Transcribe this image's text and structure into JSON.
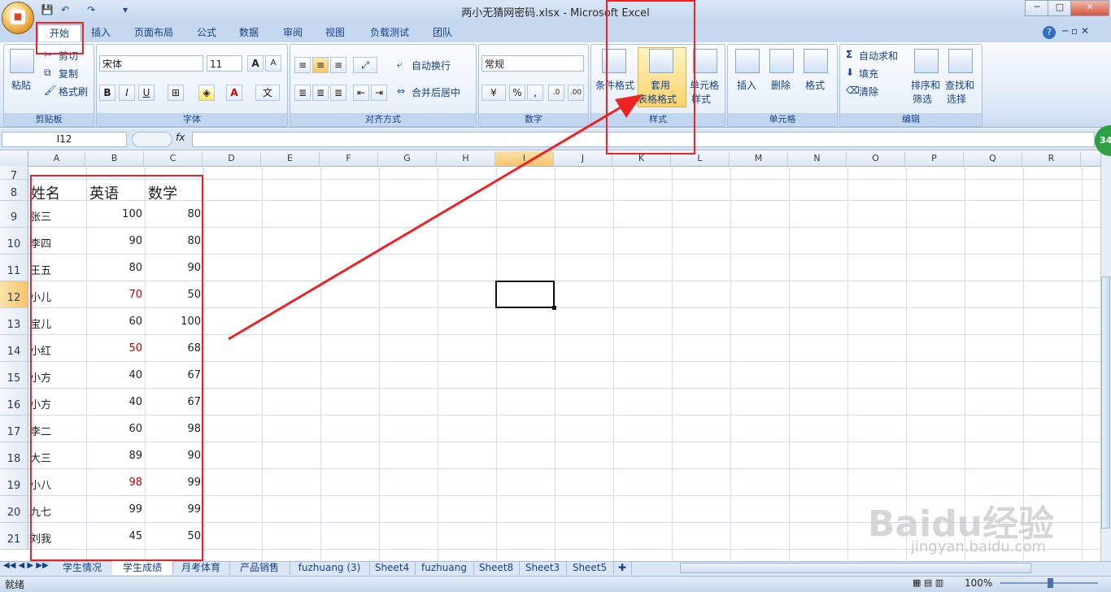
{
  "window": {
    "title": "两小无猜网密码.xlsx - Microsoft Excel",
    "min": "─",
    "max": "□",
    "close": "✕"
  },
  "quick_access": {
    "save": "💾",
    "undo": "↶",
    "redo": "↷",
    "more": "▾"
  },
  "tabs": [
    "开始",
    "插入",
    "页面布局",
    "公式",
    "数据",
    "审阅",
    "视图",
    "负载测试",
    "团队"
  ],
  "ribbon": {
    "clipboard": {
      "paste": "粘贴",
      "cut": "剪切",
      "copy": "复制",
      "format_painter": "格式刷",
      "label": "剪贴板"
    },
    "font": {
      "name": "宋体",
      "size": "11",
      "grow": "A",
      "shrink": "A",
      "bold": "B",
      "italic": "I",
      "underline": "U",
      "label": "字体"
    },
    "alignment": {
      "wrap": "自动换行",
      "merge": "合并后居中",
      "label": "对齐方式"
    },
    "number": {
      "format": "常规",
      "percent": "%",
      "comma": ",",
      "label": "数字"
    },
    "styles": {
      "conditional": "条件格式",
      "table_format_1": "套用",
      "table_format_2": "表格格式",
      "cell_style_1": "单元格",
      "cell_style_2": "样式",
      "label": "样式"
    },
    "cells": {
      "insert": "插入",
      "delete": "删除",
      "format": "格式",
      "label": "单元格"
    },
    "editing": {
      "autosum": "自动求和",
      "fill": "填充",
      "clear": "清除",
      "sort_1": "排序和",
      "sort_2": "筛选",
      "find_1": "查找和",
      "find_2": "选择",
      "label": "编辑"
    }
  },
  "formula_bar": {
    "name_box": "I12",
    "fx": "fx",
    "value": ""
  },
  "columns": [
    "A",
    "B",
    "C",
    "D",
    "E",
    "F",
    "G",
    "H",
    "I",
    "J",
    "K",
    "L",
    "M",
    "N",
    "O",
    "P",
    "Q",
    "R"
  ],
  "rows": [
    "7",
    "8",
    "9",
    "10",
    "11",
    "12",
    "13",
    "14",
    "15",
    "16",
    "17",
    "18",
    "19",
    "20",
    "21"
  ],
  "table": {
    "headers": [
      "姓名",
      "英语",
      "数学"
    ],
    "rows": [
      {
        "name": "张三",
        "en": "100",
        "math": "80",
        "en_red": false
      },
      {
        "name": "李四",
        "en": "90",
        "math": "80",
        "en_red": false
      },
      {
        "name": "王五",
        "en": "80",
        "math": "90",
        "en_red": false
      },
      {
        "name": "小儿",
        "en": "70",
        "math": "50",
        "en_red": true
      },
      {
        "name": "宝儿",
        "en": "60",
        "math": "100",
        "en_red": false
      },
      {
        "name": "小红",
        "en": "50",
        "math": "68",
        "en_red": true
      },
      {
        "name": "小方",
        "en": "40",
        "math": "67",
        "en_red": false
      },
      {
        "name": "小方",
        "en": "40",
        "math": "67",
        "en_red": false
      },
      {
        "name": "李二",
        "en": "60",
        "math": "98",
        "en_red": false
      },
      {
        "name": "大三",
        "en": "89",
        "math": "90",
        "en_red": false
      },
      {
        "name": "小八",
        "en": "98",
        "math": "99",
        "en_red": true
      },
      {
        "name": "九七",
        "en": "99",
        "math": "99",
        "en_red": false
      },
      {
        "name": "刘我",
        "en": "45",
        "math": "50",
        "en_red": false
      }
    ]
  },
  "sheets": [
    "学生情况",
    "学生成绩",
    "月考体育",
    "产品销售",
    "fuzhuang (3)",
    "Sheet4",
    "fuzhuang",
    "Sheet8",
    "Sheet3",
    "Sheet5"
  ],
  "status": {
    "ready": "就绪",
    "zoom": "100%"
  },
  "watermark": {
    "brand": "Baidu经验",
    "url": "jingyan.baidu.com"
  },
  "side_badge": "34"
}
